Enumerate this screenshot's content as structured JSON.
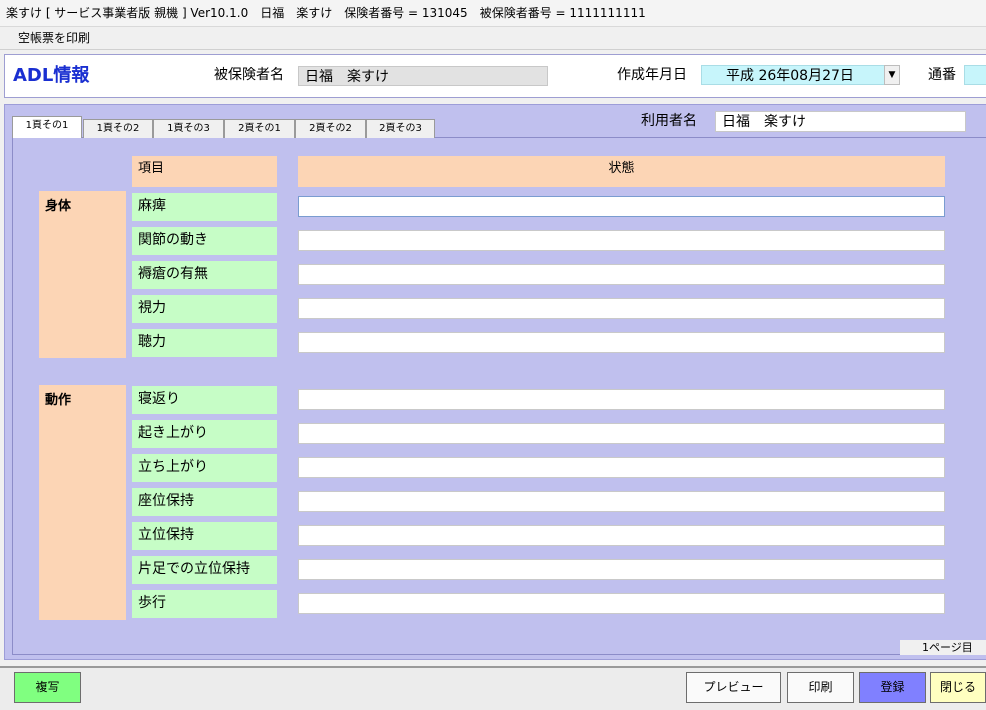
{
  "window": {
    "title": "楽すけ [ サービス事業者版 親機 ] Ver10.1.0　日福　楽すけ　保険者番号 = 131045　被保険者番号 = 1111111111"
  },
  "menu": {
    "print_blank": "空帳票を印刷"
  },
  "header": {
    "title": "ADL情報",
    "insured_label": "被保険者名",
    "insured_value": "日福　楽すけ",
    "created_label": "作成年月日",
    "created_value": "平成 26年08月27日",
    "serial_label": "通番",
    "serial_value": ""
  },
  "tabs": [
    "1頁その1",
    "1頁その2",
    "1頁その3",
    "2頁その1",
    "2頁その2",
    "2頁その3"
  ],
  "active_tab": 0,
  "user": {
    "label": "利用者名",
    "value": "日福　楽すけ"
  },
  "table": {
    "item_header": "項目",
    "status_header": "状態",
    "groups": [
      {
        "name": "身体",
        "items": [
          "麻痺",
          "関節の動き",
          "褥瘡の有無",
          "視力",
          "聴力"
        ]
      },
      {
        "name": "動作",
        "items": [
          "寝返り",
          "起き上がり",
          "立ち上がり",
          "座位保持",
          "立位保持",
          "片足での立位保持",
          "歩行"
        ]
      }
    ]
  },
  "page_label": "1ページ目",
  "footer": {
    "copy_label": "複写",
    "preview_label": "プレビュー",
    "print_label": "印刷",
    "register_label": "登録",
    "close_label": "閉じる"
  },
  "colors": {
    "accent_title": "#1a2fd1",
    "panel_bg": "#c0c0ee",
    "category_bg": "#fcd5b5",
    "item_bg": "#c6fdc6",
    "date_bg": "#c7f5fb",
    "register_btn": "#8080ff",
    "close_btn": "#ffffc0",
    "copy_btn": "#80ff80"
  }
}
